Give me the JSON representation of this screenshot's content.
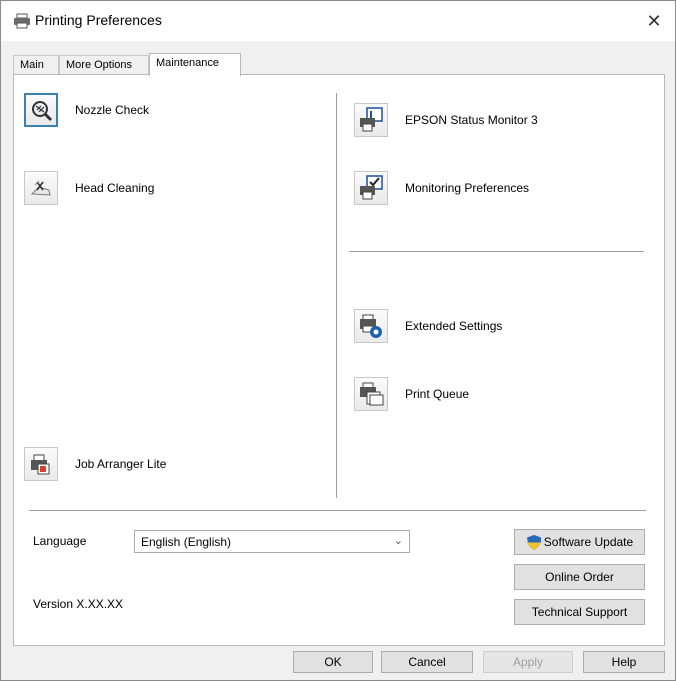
{
  "window": {
    "title": "Printing Preferences",
    "close_glyph": "✕"
  },
  "tabs": [
    {
      "label": "Main"
    },
    {
      "label": "More Options"
    },
    {
      "label": "Maintenance",
      "active": true
    }
  ],
  "maintenance": {
    "left_items": [
      {
        "label": "Nozzle Check",
        "icon": "nozzle-check-icon"
      },
      {
        "label": "Head Cleaning",
        "icon": "head-cleaning-icon"
      },
      {
        "label": "Job Arranger Lite",
        "icon": "job-arranger-icon"
      }
    ],
    "right_items": [
      {
        "label": "EPSON Status Monitor 3",
        "icon": "status-monitor-icon"
      },
      {
        "label": "Monitoring Preferences",
        "icon": "monitoring-preferences-icon"
      },
      {
        "label": "Extended Settings",
        "icon": "extended-settings-icon"
      },
      {
        "label": "Print Queue",
        "icon": "print-queue-icon"
      }
    ]
  },
  "language": {
    "label": "Language",
    "selected": "English (English)"
  },
  "version": {
    "text": "Version X.XX.XX"
  },
  "side_buttons": {
    "software_update": "Software Update",
    "online_order": "Online Order",
    "technical_support": "Technical Support"
  },
  "dialog_buttons": {
    "ok": "OK",
    "cancel": "Cancel",
    "apply": "Apply",
    "help": "Help"
  },
  "colors": {
    "selection_border": "#3c7fb1",
    "shield_blue": "#2a6ab8",
    "shield_yellow": "#f2c12e"
  }
}
